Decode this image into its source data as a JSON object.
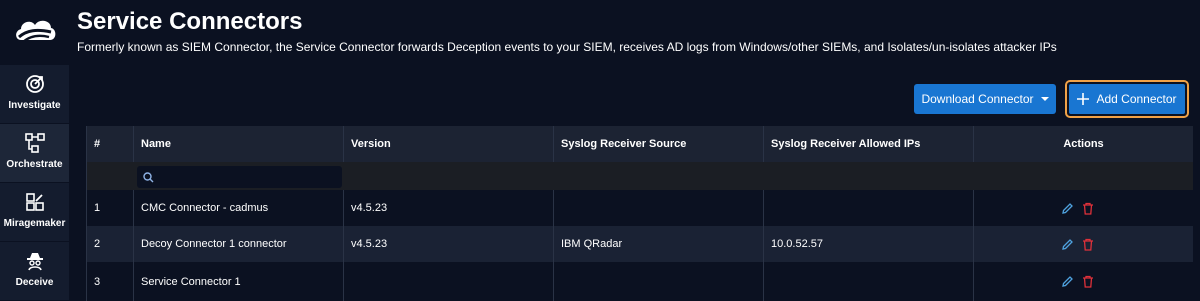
{
  "sidebar": {
    "logo": "cloud-logo-icon",
    "items": [
      {
        "label": "Investigate",
        "icon": "investigate-target-icon"
      },
      {
        "label": "Orchestrate",
        "icon": "orchestrate-flow-icon"
      },
      {
        "label": "Miragemaker",
        "icon": "miragemaker-icon"
      },
      {
        "label": "Deceive",
        "icon": "deceive-spy-icon"
      }
    ]
  },
  "header": {
    "title": "Service Connectors",
    "subtitle": "Formerly known as SIEM Connector, the Service Connector forwards Deception events to your SIEM, receives AD logs from Windows/other SIEMs, and Isolates/un-isolates attacker IPs"
  },
  "toolbar": {
    "download_label": "Download Connector",
    "add_label": "Add Connector",
    "add_icon": "plus-icon"
  },
  "table": {
    "columns": [
      "#",
      "Name",
      "Version",
      "Syslog Receiver Source",
      "Syslog Receiver Allowed IPs",
      "Actions"
    ],
    "filter_placeholder": "",
    "rows": [
      {
        "num": "1",
        "name": "CMC Connector - cadmus",
        "version": "v4.5.23",
        "source": "",
        "ips": ""
      },
      {
        "num": "2",
        "name": "Decoy Connector 1 connector",
        "version": "v4.5.23",
        "source": "IBM QRadar",
        "ips": "10.0.52.57"
      },
      {
        "num": "3",
        "name": "Service Connector 1",
        "version": "",
        "source": "",
        "ips": ""
      }
    ]
  },
  "colors": {
    "background": "#0b1121",
    "accent": "#1976d2",
    "focus_outline": "#f0a248",
    "edit_icon": "#4fa3e0",
    "delete_icon": "#e0313a"
  }
}
